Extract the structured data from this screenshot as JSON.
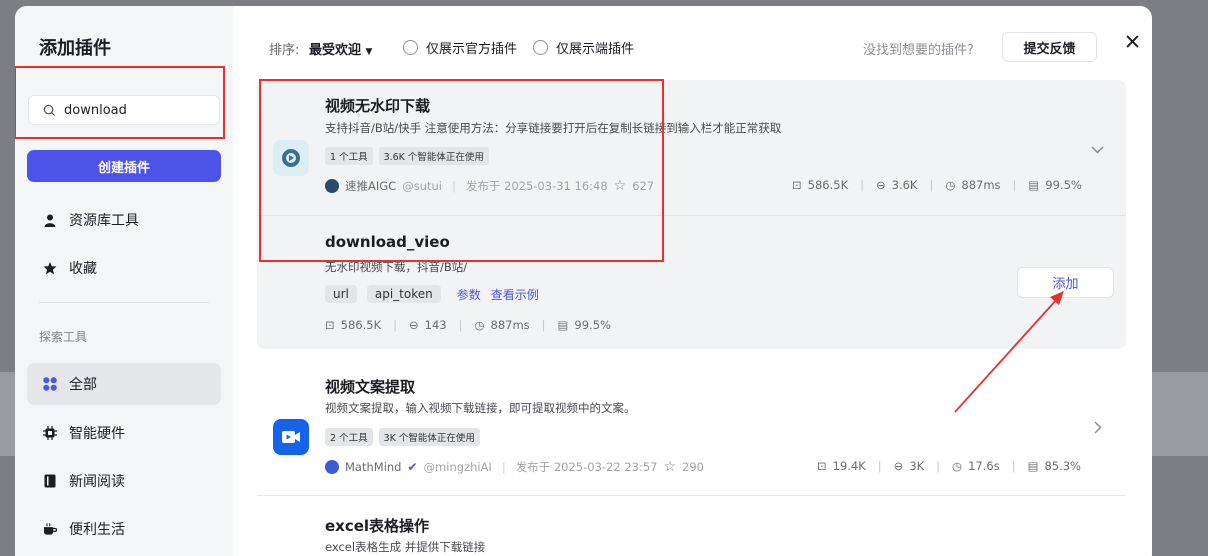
{
  "sidebar": {
    "title": "添加插件",
    "search_value": "download",
    "create_button": "创建插件",
    "top_items": [
      {
        "label": "资源库工具",
        "icon": "person-icon"
      },
      {
        "label": "收藏",
        "icon": "star-icon"
      }
    ],
    "section_label": "探索工具",
    "explore_items": [
      {
        "label": "全部",
        "icon": "grid-icon",
        "active": true
      },
      {
        "label": "智能硬件",
        "icon": "chip-icon"
      },
      {
        "label": "新闻阅读",
        "icon": "book-icon"
      },
      {
        "label": "便利生活",
        "icon": "cup-icon"
      }
    ]
  },
  "topbar": {
    "sort_label": "排序:",
    "sort_value": "最受欢迎",
    "radio_official": "仅展示官方插件",
    "radio_client": "仅展示端插件",
    "not_found": "没找到想要的插件?",
    "feedback_button": "提交反馈"
  },
  "plugins": [
    {
      "name": "视频无水印下载",
      "description": "支持抖音/B站/快手 注意使用方法：分享链接要打开后在复制长链接到输入栏才能正常获取",
      "tags": [
        "1 个工具",
        "3.6K 个智能体正在使用"
      ],
      "author": "速推AIGC",
      "handle": "@sutui",
      "published": "发布于 2025-03-31 16:48",
      "favorites": "627",
      "stats": {
        "calls": "586.5K",
        "bots": "3.6K",
        "latency": "887ms",
        "success": "99.5%"
      },
      "tool": {
        "name": "download_vieo",
        "description": "无水印视频下载，抖音/B站/",
        "params": [
          "url",
          "api_token"
        ],
        "params_link": "参数",
        "example_link": "查看示例",
        "stats": {
          "calls": "586.5K",
          "bots": "143",
          "latency": "887ms",
          "success": "99.5%"
        },
        "add_button": "添加"
      }
    },
    {
      "name": "视频文案提取",
      "description": "视频文案提取，输入视频下载链接，即可提取视频中的文案。",
      "tags": [
        "2 个工具",
        "3K 个智能体正在使用"
      ],
      "author": "MathMind",
      "handle": "@mingzhiAI",
      "published": "发布于 2025-03-22 23:57",
      "favorites": "290",
      "stats": {
        "calls": "19.4K",
        "bots": "3K",
        "latency": "17.6s",
        "success": "85.3%"
      }
    },
    {
      "name": "excel表格操作",
      "description": "excel表格生成 并提供下载链接"
    }
  ],
  "colors": {
    "accent": "#4d53e8",
    "highlight": "#e8302d",
    "sidebar_bg": "#f4f5f7"
  }
}
